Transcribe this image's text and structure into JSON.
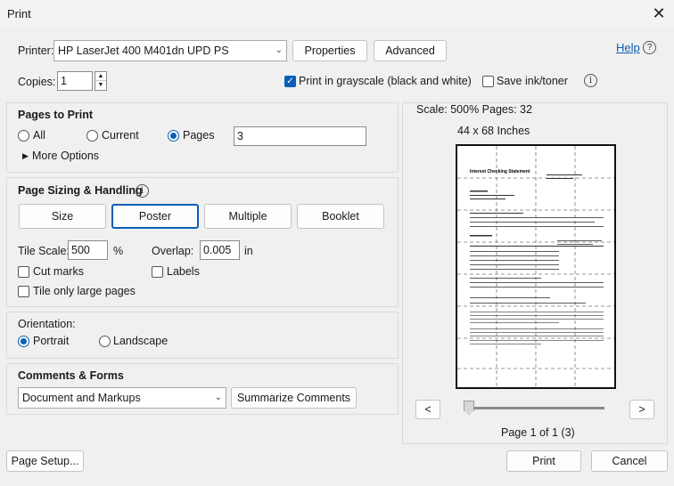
{
  "window": {
    "title": "Print",
    "close_glyph": "✕"
  },
  "printer": {
    "label": "Printer:",
    "value": "HP LaserJet 400 M401dn UPD PS",
    "properties_btn": "Properties",
    "advanced_btn": "Advanced",
    "help_link": "Help",
    "help_icon": "?"
  },
  "copies": {
    "label": "Copies:",
    "value": "1"
  },
  "options": {
    "grayscale_label": "Print in grayscale (black and white)",
    "grayscale_checked": true,
    "save_ink_label": "Save ink/toner",
    "save_ink_checked": false,
    "info_icon": "i"
  },
  "pages_to_print": {
    "heading": "Pages to Print",
    "all": "All",
    "current": "Current",
    "pages": "Pages",
    "pages_value": "3",
    "more_options": "More Options",
    "selected": "pages"
  },
  "sizing": {
    "heading": "Page Sizing & Handling",
    "buttons": [
      "Size",
      "Poster",
      "Multiple",
      "Booklet"
    ],
    "selected": "Poster",
    "tile_scale_label": "Tile Scale:",
    "tile_scale_value": "500",
    "tile_scale_unit": "%",
    "overlap_label": "Overlap:",
    "overlap_value": "0.005",
    "overlap_unit": "in",
    "cut_marks": "Cut marks",
    "labels": "Labels",
    "tile_only_large": "Tile only large pages"
  },
  "orientation": {
    "heading": "Orientation:",
    "portrait": "Portrait",
    "landscape": "Landscape",
    "selected": "portrait"
  },
  "comments": {
    "heading": "Comments & Forms",
    "value": "Document and Markups",
    "summarize_btn": "Summarize Comments"
  },
  "preview": {
    "scale_text": "Scale: 500% Pages: 32",
    "size_text": "44 x 68 Inches",
    "doc_title": "Interest Checking Statement",
    "prev_btn": "<",
    "next_btn": ">",
    "page_indicator": "Page 1 of 1 (3)",
    "slider_position": 0
  },
  "footer": {
    "page_setup_btn": "Page Setup...",
    "print_btn": "Print",
    "cancel_btn": "Cancel"
  }
}
